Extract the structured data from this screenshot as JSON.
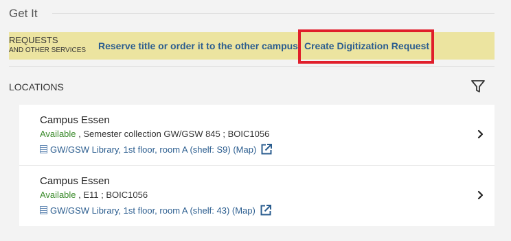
{
  "section": {
    "title": "Get It"
  },
  "requests": {
    "label_line1": "REQUESTS",
    "label_line2": "AND OTHER SERVICES",
    "reserve_link": "Reserve title or order it to the other campus",
    "digitization_link": "Create Digitization Request",
    "highlight_color": "#e01e2b",
    "bar_color": "#ece4a0"
  },
  "locations": {
    "label": "LOCATIONS",
    "items": [
      {
        "name": "Campus Essen",
        "availability": "Available",
        "details": " , Semester collection GW/GSW 845 ; BOIC1056",
        "location_link": "GW/GSW Library, 1st floor, room A (shelf: S9) (Map)"
      },
      {
        "name": "Campus Essen",
        "availability": "Available",
        "details": " , E11 ; BOIC1056",
        "location_link": "GW/GSW Library, 1st floor, room A (shelf: 43) (Map)"
      }
    ]
  },
  "icons": {
    "filter": "filter-icon",
    "chevron": "chevron-right-icon",
    "external": "external-link-icon",
    "shelf": "shelf-icon"
  },
  "colors": {
    "link": "#2b5d8f",
    "available": "#3a8a2a",
    "background": "#f3f3f3"
  }
}
